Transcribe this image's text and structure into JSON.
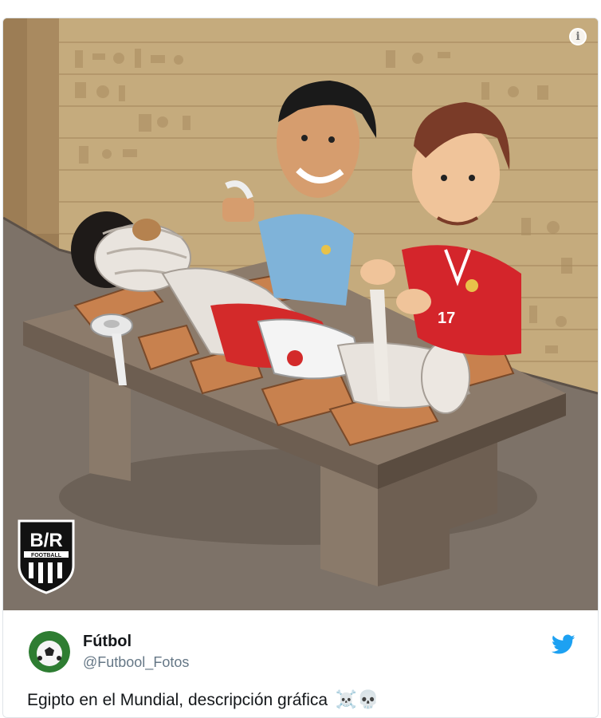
{
  "tweet": {
    "display_name": "Fútbol",
    "handle": "@Futbool_Fotos",
    "text": "Egipto en el Mundial, descripción gráfica",
    "emoji": "☠️💀"
  },
  "media": {
    "logo_text": "B/R FOOTBALL",
    "jersey_number": "17"
  },
  "icons": {
    "info": "info-icon",
    "twitter": "twitter-bird-icon",
    "avatar": "soccer-ball-avatar"
  },
  "colors": {
    "twitter_blue": "#1da1f2",
    "handle_gray": "#657786",
    "text": "#14171a"
  }
}
